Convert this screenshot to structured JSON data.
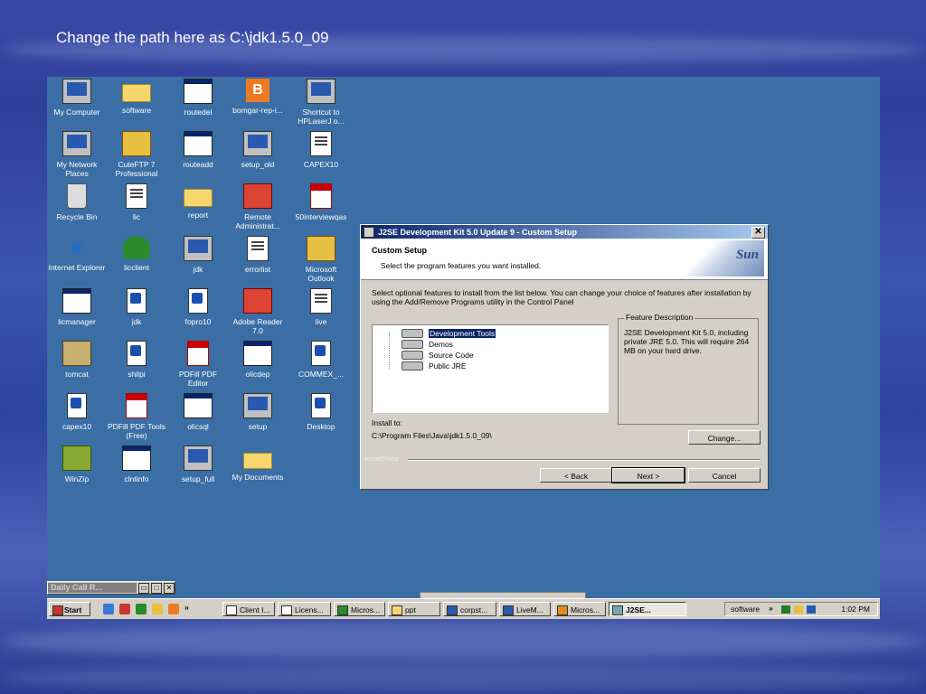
{
  "slide_title": "Change the path here as C:\\jdk1.5.0_09",
  "desktop_icons": [
    {
      "label": "My Computer",
      "icon": "computer-icon"
    },
    {
      "label": "software",
      "icon": "folder-icon"
    },
    {
      "label": "routedel",
      "icon": "window-icon"
    },
    {
      "label": "bomgar-rep-i...",
      "icon": "bomgar-icon"
    },
    {
      "label": "Shortcut to HPLaserJ o...",
      "icon": "printer-icon"
    },
    {
      "label": "My Network Places",
      "icon": "network-icon"
    },
    {
      "label": "CuteFTP 7 Professional",
      "icon": "cuteftp-icon"
    },
    {
      "label": "routeadd",
      "icon": "window-icon"
    },
    {
      "label": "setup_old",
      "icon": "setup-icon"
    },
    {
      "label": "CAPEX10",
      "icon": "capex-icon"
    },
    {
      "label": "Recycle Bin",
      "icon": "recycle-bin-icon"
    },
    {
      "label": "lic",
      "icon": "document-icon"
    },
    {
      "label": "report",
      "icon": "folder-icon"
    },
    {
      "label": "Remote Administrat...",
      "icon": "remote-admin-icon"
    },
    {
      "label": "50interviewqas",
      "icon": "pdf-icon"
    },
    {
      "label": "Internet Explorer",
      "icon": "internet-explorer-icon"
    },
    {
      "label": "licclient",
      "icon": "tree-icon"
    },
    {
      "label": "jdk",
      "icon": "setup-icon"
    },
    {
      "label": "errorlist",
      "icon": "excel-icon"
    },
    {
      "label": "Microsoft Outlook",
      "icon": "outlook-icon"
    },
    {
      "label": "licmanager",
      "icon": "window-icon"
    },
    {
      "label": "jdk",
      "icon": "script-icon"
    },
    {
      "label": "fopro10",
      "icon": "script-icon"
    },
    {
      "label": "Adobe Reader 7.0",
      "icon": "adobe-reader-icon"
    },
    {
      "label": "live",
      "icon": "document-icon"
    },
    {
      "label": "tomcat",
      "icon": "tomcat-icon"
    },
    {
      "label": "shilpi",
      "icon": "script-icon"
    },
    {
      "label": "PDFill PDF Editor",
      "icon": "pdf-editor-icon"
    },
    {
      "label": "olicdep",
      "icon": "window-icon"
    },
    {
      "label": "COMMEX_...",
      "icon": "script-icon"
    },
    {
      "label": "capex10",
      "icon": "script-icon"
    },
    {
      "label": "PDFill PDF Tools (Free)",
      "icon": "pdf-tools-icon"
    },
    {
      "label": "olicsql",
      "icon": "window-icon"
    },
    {
      "label": "setup",
      "icon": "setup-icon"
    },
    {
      "label": "Desktop",
      "icon": "script-icon"
    },
    {
      "label": "WinZip",
      "icon": "winzip-icon"
    },
    {
      "label": "clntinfo",
      "icon": "window-icon"
    },
    {
      "label": "setup_full",
      "icon": "setup-icon"
    },
    {
      "label": "My Documents",
      "icon": "my-documents-icon"
    }
  ],
  "dialog": {
    "title": "J2SE Development Kit 5.0 Update 9 - Custom Setup",
    "header_title": "Custom Setup",
    "header_subtitle": "Select the program features you want installed.",
    "logo_text": "Sun",
    "instructions": "Select optional features to install from the list below.  You can change your choice of features after installation by using the Add/Remove Programs utility in the Control Panel",
    "features": [
      "Development Tools",
      "Demos",
      "Source Code",
      "Public JRE"
    ],
    "feature_desc_label": "Feature Description",
    "feature_desc_text": "J2SE Development Kit 5.0, including private JRE 5.0.  This will require 264 MB on your hard drive.",
    "install_to_label": "Install to:",
    "install_path": "C:\\Program Files\\Java\\jdk1.5.0_09\\",
    "change_button": "Change...",
    "installshield_label": "InstallShield",
    "back_button": "< Back",
    "next_button": "Next >",
    "cancel_button": "Cancel"
  },
  "minibar": {
    "title": "Daily Call R..."
  },
  "taskbar": {
    "start_label": "Start",
    "more_label": "»",
    "items": [
      "Client I...",
      "Licens...",
      "Micros...",
      "ppt",
      "corpst...",
      "LiveM...",
      "Micros...",
      "J2SE..."
    ],
    "tray_label": "software",
    "tray_more": "»",
    "clock": "1:02 PM"
  }
}
